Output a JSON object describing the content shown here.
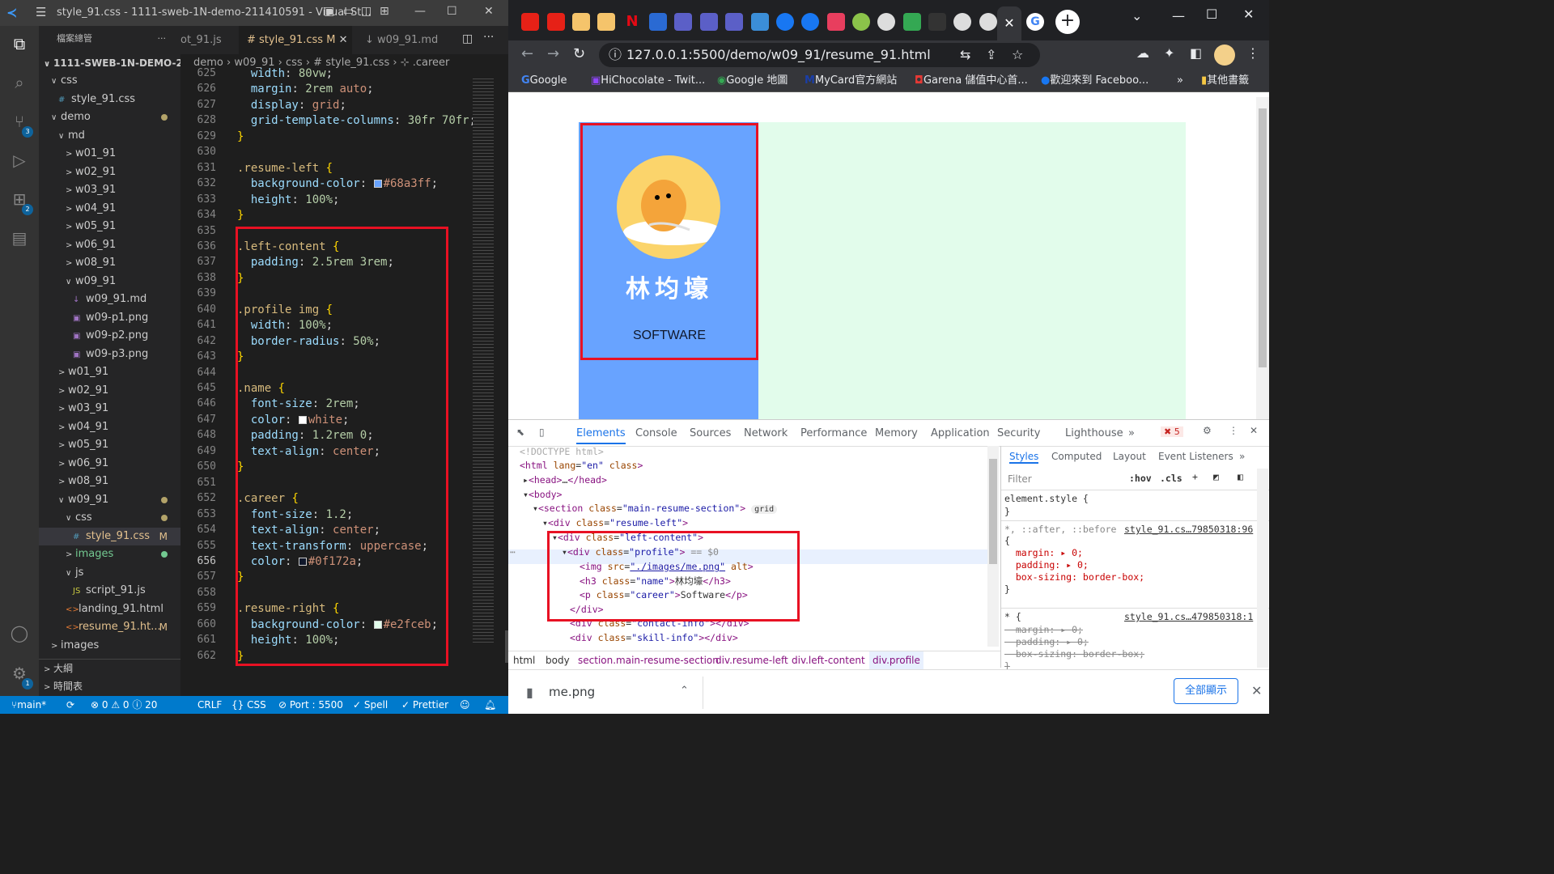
{
  "vscode": {
    "title": "style_91.css - 1111-sweb-1N-demo-211410591 - Visual St...",
    "explorer_label": "檔案總管",
    "root": "1111-SWEB-1N-DEMO-21...",
    "tree": [
      {
        "label": "css",
        "chev": "∨",
        "indent": 1
      },
      {
        "label": "style_91.css",
        "icon": "#",
        "indent": 2
      },
      {
        "label": "demo",
        "chev": "∨",
        "indent": 1,
        "dot": true
      },
      {
        "label": "md",
        "chev": "∨",
        "indent": 2
      },
      {
        "label": "w01_91",
        "chev": ">",
        "indent": 3
      },
      {
        "label": "w02_91",
        "chev": ">",
        "indent": 3
      },
      {
        "label": "w03_91",
        "chev": ">",
        "indent": 3
      },
      {
        "label": "w04_91",
        "chev": ">",
        "indent": 3
      },
      {
        "label": "w05_91",
        "chev": ">",
        "indent": 3
      },
      {
        "label": "w06_91",
        "chev": ">",
        "indent": 3
      },
      {
        "label": "w08_91",
        "chev": ">",
        "indent": 3
      },
      {
        "label": "w09_91",
        "chev": "∨",
        "indent": 3
      },
      {
        "label": "w09_91.md",
        "icon": "↓",
        "indent": 4
      },
      {
        "label": "w09-p1.png",
        "icon": "▣",
        "indent": 4
      },
      {
        "label": "w09-p2.png",
        "icon": "▣",
        "indent": 4
      },
      {
        "label": "w09-p3.png",
        "icon": "▣",
        "indent": 4
      },
      {
        "label": "w01_91",
        "chev": ">",
        "indent": 2
      },
      {
        "label": "w02_91",
        "chev": ">",
        "indent": 2
      },
      {
        "label": "w03_91",
        "chev": ">",
        "indent": 2
      },
      {
        "label": "w04_91",
        "chev": ">",
        "indent": 2
      },
      {
        "label": "w05_91",
        "chev": ">",
        "indent": 2
      },
      {
        "label": "w06_91",
        "chev": ">",
        "indent": 2
      },
      {
        "label": "w08_91",
        "chev": ">",
        "indent": 2
      },
      {
        "label": "w09_91",
        "chev": "∨",
        "indent": 2,
        "dot": true
      },
      {
        "label": "css",
        "chev": "∨",
        "indent": 3,
        "dot": true
      },
      {
        "label": "style_91.css",
        "icon": "#",
        "indent": 4,
        "mark": "M",
        "sel": true
      },
      {
        "label": "images",
        "chev": ">",
        "indent": 3,
        "gdot": true
      },
      {
        "label": "js",
        "chev": "∨",
        "indent": 3
      },
      {
        "label": "script_91.js",
        "icon": "JS",
        "indent": 4
      },
      {
        "label": "landing_91.html",
        "icon": "<>",
        "indent": 3
      },
      {
        "label": "resume_91.ht...",
        "icon": "<>",
        "indent": 3,
        "mark": "M"
      },
      {
        "label": "images",
        "chev": ">",
        "indent": 1
      }
    ],
    "outline_label": "大綱",
    "timeline_label": "時間表",
    "tabs": [
      "ot_91.js",
      "# style_91.css M",
      "↓ w09_91.md"
    ],
    "breadcrumb": "demo › w09_91 › css › # style_91.css › ⊹ .career",
    "lines": [
      {
        "n": "625",
        "html": "  <span class='prop'>width</span>: <span class='num'>80vw</span>;"
      },
      {
        "n": "626",
        "html": "  <span class='prop'>margin</span>: <span class='num'>2rem</span> <span class='val'>auto</span>;"
      },
      {
        "n": "627",
        "html": "  <span class='prop'>display</span>: <span class='val'>grid</span>;"
      },
      {
        "n": "628",
        "html": "  <span class='prop'>grid-template-columns</span>: <span class='num'>30fr</span> <span class='num'>70fr</span>;"
      },
      {
        "n": "629",
        "html": "<span class='br'>}</span>"
      },
      {
        "n": "630",
        "html": ""
      },
      {
        "n": "631",
        "html": "<span class='sel-t'>.resume-left</span> <span class='br'>{</span>"
      },
      {
        "n": "632",
        "html": "  <span class='prop'>background-color</span>: <i class='sw' style='background:#68a3ff'></i><span class='val'>#68a3ff</span>;"
      },
      {
        "n": "633",
        "html": "  <span class='prop'>height</span>: <span class='num'>100%</span>;"
      },
      {
        "n": "634",
        "html": "<span class='br'>}</span>"
      },
      {
        "n": "635",
        "html": ""
      },
      {
        "n": "636",
        "html": "<span class='sel-t'>.left-content</span> <span class='br'>{</span>"
      },
      {
        "n": "637",
        "html": "  <span class='prop'>padding</span>: <span class='num'>2.5rem</span> <span class='num'>3rem</span>;"
      },
      {
        "n": "638",
        "html": "<span class='br'>}</span>"
      },
      {
        "n": "639",
        "html": ""
      },
      {
        "n": "640",
        "html": "<span class='sel-t'>.profile img</span> <span class='br'>{</span>"
      },
      {
        "n": "641",
        "html": "  <span class='prop'>width</span>: <span class='num'>100%</span>;"
      },
      {
        "n": "642",
        "html": "  <span class='prop'>border-radius</span>: <span class='num'>50%</span>;"
      },
      {
        "n": "643",
        "html": "<span class='br'>}</span>"
      },
      {
        "n": "644",
        "html": ""
      },
      {
        "n": "645",
        "html": "<span class='sel-t'>.name</span> <span class='br'>{</span>"
      },
      {
        "n": "646",
        "html": "  <span class='prop'>font-size</span>: <span class='num'>2rem</span>;"
      },
      {
        "n": "647",
        "html": "  <span class='prop'>color</span>: <i class='sw' style='background:#fff'></i><span class='val'>white</span>;"
      },
      {
        "n": "648",
        "html": "  <span class='prop'>padding</span>: <span class='num'>1.2rem</span> <span class='num'>0</span>;"
      },
      {
        "n": "649",
        "html": "  <span class='prop'>text-align</span>: <span class='val'>center</span>;"
      },
      {
        "n": "650",
        "html": "<span class='br'>}</span>"
      },
      {
        "n": "651",
        "html": ""
      },
      {
        "n": "652",
        "html": "<span class='sel-t'>.career</span> <span class='br'>{</span>"
      },
      {
        "n": "653",
        "html": "  <span class='prop'>font-size</span>: <span class='num'>1.2</span>;"
      },
      {
        "n": "654",
        "html": "  <span class='prop'>text-align</span>: <span class='val'>center</span>;"
      },
      {
        "n": "655",
        "html": "  <span class='prop'>text-transform</span>: <span class='val'>uppercase</span>;"
      },
      {
        "n": "656",
        "html": "  <span class='prop'>color</span>: <i class='sw' style='background:#0f172a'></i><span class='val'>#0f172a</span>;"
      },
      {
        "n": "657",
        "html": "<span class='br'>}</span>"
      },
      {
        "n": "658",
        "html": ""
      },
      {
        "n": "659",
        "html": "<span class='sel-t'>.resume-right</span> <span class='br'>{</span>"
      },
      {
        "n": "660",
        "html": "  <span class='prop'>background-color</span>: <i class='sw' style='background:#e2fceb'></i><span class='val'>#e2fceb</span>;"
      },
      {
        "n": "661",
        "html": "  <span class='prop'>height</span>: <span class='num'>100%</span>;"
      },
      {
        "n": "662",
        "html": "<span class='br'>}</span>"
      }
    ],
    "status": {
      "branch": "main*",
      "problems": "⊗ 0 ⚠ 0 ⓘ 20",
      "eol": "CRLF",
      "lang": "{} CSS",
      "port": "⊘ Port : 5500",
      "spell": "✓ Spell",
      "prettier": "✓ Prettier"
    }
  },
  "chrome": {
    "url": "127.0.0.1:5500/demo/w09_91/resume_91.html",
    "bookmarks": [
      "Google",
      "HiChocolate - Twit...",
      "Google 地圖",
      "MyCard官方網站",
      "Garena 儲值中心首...",
      "歡迎來到 Faceboo...",
      "»",
      "其他書籤"
    ],
    "page": {
      "name": "林均壕",
      "career": "SOFTWARE",
      "colors": {
        "left": "#68a3ff",
        "right": "#e2fceb"
      }
    },
    "devtools": {
      "tabs": [
        "Elements",
        "Console",
        "Sources",
        "Network",
        "Performance",
        "Memory",
        "Application",
        "Security",
        "Lighthouse",
        "»"
      ],
      "error_count": "5",
      "styles_tabs": [
        "Styles",
        "Computed",
        "Layout",
        "Event Listeners",
        "»"
      ],
      "filter_placeholder": "Filter",
      "hov": ":hov",
      "cls": ".cls",
      "dom_crumbs": [
        "html",
        "body",
        "section.main-resume-section",
        "div.resume-left",
        "div.left-content",
        "div.profile"
      ],
      "style_rule1_sel": "element.style {",
      "style_rule1_end": "}",
      "style_rule2_sel": "*, ::after, ::before",
      "style_rule2_src": "style_91.cs…79850318:96",
      "style_rule2_lines": [
        "{",
        "  margin: ▸ 0;",
        "  padding: ▸ 0;",
        "  box-sizing: border-box;",
        "}"
      ],
      "style_rule3_sel": "* {",
      "style_rule3_src": "style_91.cs…479850318:1",
      "style_rule3_lines": [
        "  margin: ▸ 0;",
        "  padding: ▸ 0;",
        "  box-sizing: border-box;",
        "}"
      ]
    },
    "download": {
      "file": "me.png",
      "show_all": "全部顯示"
    }
  }
}
